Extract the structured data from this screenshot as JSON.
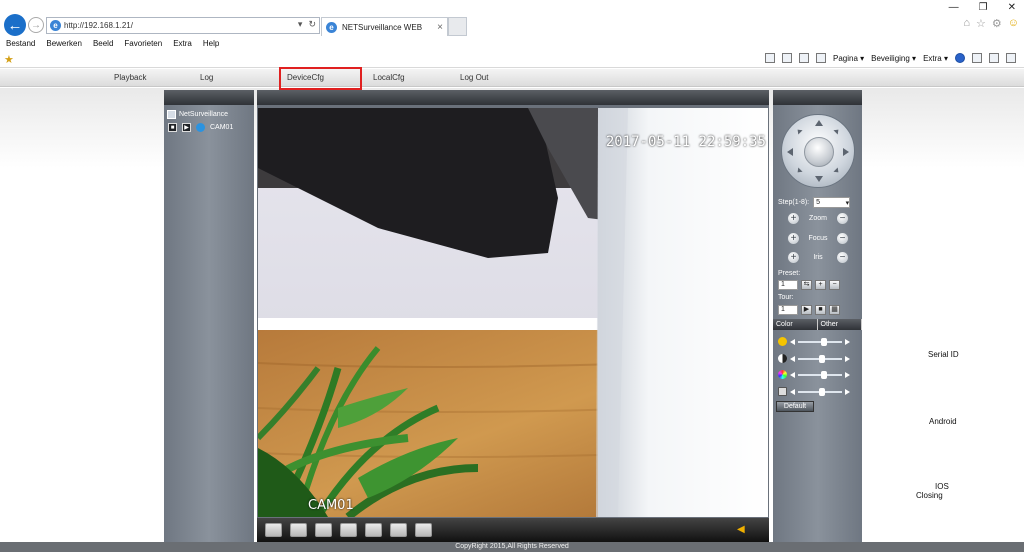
{
  "browser": {
    "url": "http://192.168.1.21/",
    "tab_title": "NETSurveillance WEB",
    "menu": [
      "Bestand",
      "Bewerken",
      "Beeld",
      "Favorieten",
      "Extra",
      "Help"
    ],
    "cmd": {
      "pagina": "Pagina ▾",
      "beveiliging": "Beveiliging ▾",
      "extra": "Extra ▾"
    }
  },
  "app": {
    "nav": [
      "Playback",
      "Log",
      "DeviceCfg",
      "LocalCfg",
      "Log Out"
    ],
    "tree": {
      "root": "NetSurveillance",
      "channel": "CAM01"
    },
    "video": {
      "timestamp": "2017-05-11 22:59:35",
      "channel_label": "CAM01"
    },
    "ptz": {
      "step_label": "Step(1-8):",
      "step_value": "5",
      "zoom_label": "Zoom",
      "focus_label": "Focus",
      "iris_label": "Iris",
      "preset_label": "Preset:",
      "preset_value": "1",
      "tour_label": "Tour:",
      "tour_value": "1"
    },
    "color_tabs": [
      "Color",
      "Other"
    ],
    "sliders": [
      0.6,
      0.55,
      0.6,
      0.55
    ],
    "default_label": "Default",
    "side_links": {
      "serial": "Serial ID",
      "android": "Android",
      "ios": "IOS",
      "closing": "Closing"
    },
    "footer": "CopyRight 2015,All Rights Reserved"
  },
  "colors": {
    "highlight": "#e02020",
    "panel": "#7a818b"
  }
}
